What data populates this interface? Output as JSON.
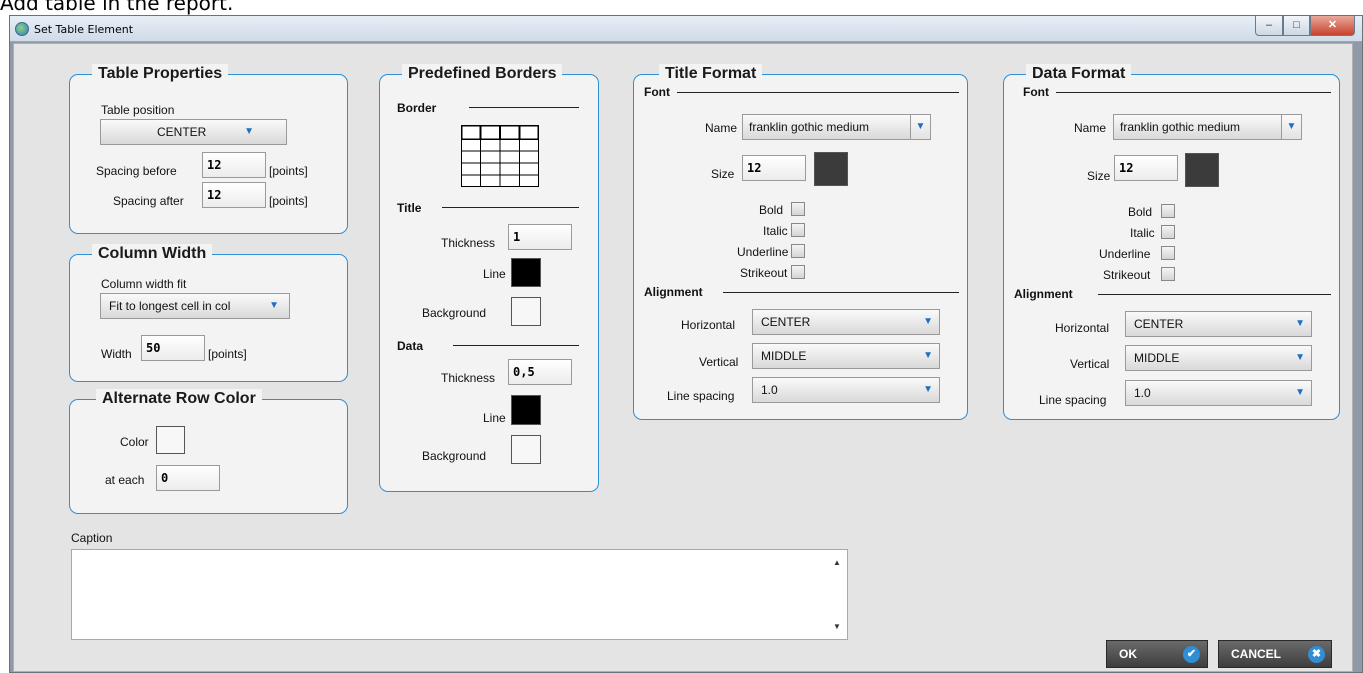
{
  "page_caption": "Add table in the report.",
  "window": {
    "title": "Set Table Element",
    "min_label": "–",
    "max_label": "□",
    "close_label": "✕"
  },
  "table_properties": {
    "title": "Table Properties",
    "position_label": "Table position",
    "position_value": "CENTER",
    "spacing_before_label": "Spacing before",
    "spacing_before_value": "12",
    "spacing_after_label": "Spacing after",
    "spacing_after_value": "12",
    "points": "[points]"
  },
  "column_width": {
    "title": "Column Width",
    "fit_label": "Column width fit",
    "fit_value": "Fit to longest cell in col",
    "width_label": "Width",
    "width_value": "50",
    "points": "[points]"
  },
  "alternate_row": {
    "title": "Alternate Row Color",
    "color_label": "Color",
    "color_value": "#f7f7f7",
    "each_label": "at each",
    "each_value": "0"
  },
  "predefined_borders": {
    "title": "Predefined Borders",
    "border_label": "Border",
    "title_section": "Title",
    "title_thickness_label": "Thickness",
    "title_thickness": "1",
    "title_line_label": "Line",
    "title_line_color": "#000000",
    "title_bg_label": "Background",
    "title_bg_color": "#f7f7f7",
    "data_section": "Data",
    "data_thickness_label": "Thickness",
    "data_thickness": "0,5",
    "data_line_label": "Line",
    "data_line_color": "#000000",
    "data_bg_label": "Background",
    "data_bg_color": "#f7f7f7"
  },
  "title_format": {
    "title": "Title Format",
    "font_section": "Font",
    "name_label": "Name",
    "name_value": "franklin gothic medium",
    "size_label": "Size",
    "size_value": "12",
    "color": "#3b3b3b",
    "bold_label": "Bold",
    "italic_label": "Italic",
    "underline_label": "Underline",
    "strikeout_label": "Strikeout",
    "alignment_section": "Alignment",
    "horizontal_label": "Horizontal",
    "horizontal_value": "CENTER",
    "vertical_label": "Vertical",
    "vertical_value": "MIDDLE",
    "spacing_label": "Line spacing",
    "spacing_value": "1.0"
  },
  "data_format": {
    "title": "Data Format",
    "font_section": "Font",
    "name_label": "Name",
    "name_value": "franklin gothic medium",
    "size_label": "Size",
    "size_value": "12",
    "color": "#3b3b3b",
    "bold_label": "Bold",
    "italic_label": "Italic",
    "underline_label": "Underline",
    "strikeout_label": "Strikeout",
    "alignment_section": "Alignment",
    "horizontal_label": "Horizontal",
    "horizontal_value": "CENTER",
    "vertical_label": "Vertical",
    "vertical_value": "MIDDLE",
    "spacing_label": "Line spacing",
    "spacing_value": "1.0"
  },
  "caption": {
    "label": "Caption",
    "value": ""
  },
  "buttons": {
    "ok": "OK",
    "cancel": "CANCEL"
  },
  "icons": {
    "ok": "check-icon",
    "cancel": "close-icon",
    "dropdown": "chevron-down-icon"
  },
  "colors": {
    "accent": "#2e8fd4",
    "panel_bg": "#f3f3f3",
    "client_bg": "#e4e4e4"
  }
}
